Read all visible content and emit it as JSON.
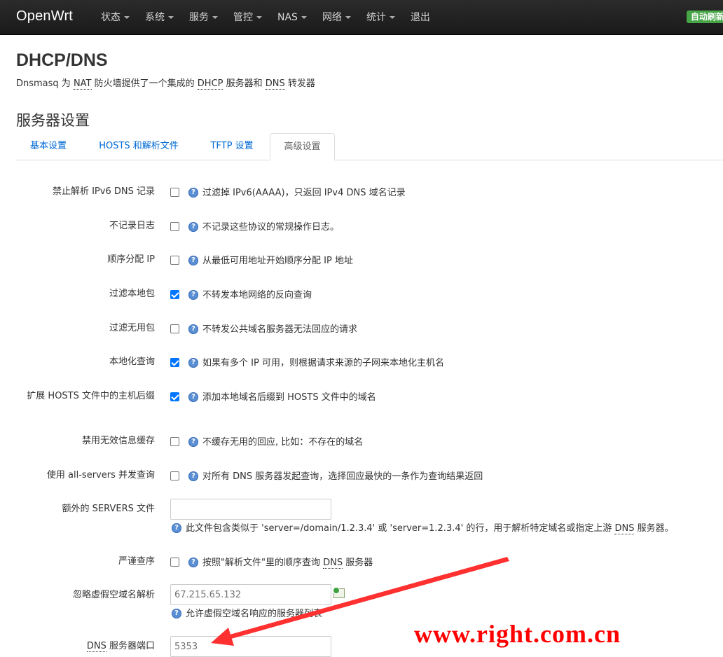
{
  "navbar": {
    "brand": "OpenWrt",
    "menu": [
      "状态",
      "系统",
      "服务",
      "管控",
      "NAS",
      "网络",
      "统计",
      "退出"
    ],
    "auto_refresh": "自动刷新"
  },
  "page": {
    "title": "DHCP/DNS",
    "description": {
      "p1": "Dnsmasq 为 ",
      "nat": "NAT",
      "p2": " 防火墙提供了一个集成的 ",
      "dhcp": "DHCP",
      "p3": " 服务器和 ",
      "dns": "DNS",
      "p4": " 转发器"
    },
    "section_title": "服务器设置"
  },
  "tabs": [
    {
      "label": "基本设置",
      "active": false
    },
    {
      "label": "HOSTS 和解析文件",
      "active": false
    },
    {
      "label": "TFTP 设置",
      "active": false
    },
    {
      "label": "高级设置",
      "active": true
    }
  ],
  "options": [
    {
      "label": "禁止解析 IPv6 DNS 记录",
      "checked": false,
      "help": "过滤掉 IPv6(AAAA)，只返回 IPv4 DNS 域名记录"
    },
    {
      "label": "不记录日志",
      "checked": false,
      "help": "不记录这些协议的常规操作日志。"
    },
    {
      "label": "顺序分配 IP",
      "checked": false,
      "help": "从最低可用地址开始顺序分配 IP 地址"
    },
    {
      "label": "过滤本地包",
      "checked": true,
      "help": "不转发本地网络的反向查询"
    },
    {
      "label": "过滤无用包",
      "checked": false,
      "help": "不转发公共域名服务器无法回应的请求"
    },
    {
      "label": "本地化查询",
      "checked": true,
      "help": "如果有多个 IP 可用，则根据请求来源的子网来本地化主机名"
    },
    {
      "label": "扩展 HOSTS 文件中的主机后缀",
      "checked": true,
      "help": "添加本地域名后缀到 HOSTS 文件中的域名"
    },
    {
      "label": "禁用无效信息缓存",
      "checked": false,
      "help": "不缓存无用的回应, 比如：不存在的域名"
    },
    {
      "label": "使用 all-servers 并发查询",
      "checked": false,
      "help": "对所有 DNS 服务器发起查询，选择回应最快的一条作为查询结果返回"
    }
  ],
  "servers_file": {
    "label": "额外的 SERVERS 文件",
    "value": "",
    "help_before": "此文件包含类似于 'server=/domain/1.2.3.4' 或 'server=1.2.3.4' 的行，用于解析特定域名或指定上游 ",
    "help_dns": "DNS",
    "help_after": " 服务器。"
  },
  "strict_order": {
    "label": "严谨查序",
    "checked": false,
    "help_before": "按照\"解析文件\"里的顺序查询 ",
    "help_dns": "DNS",
    "help_after": " 服务器"
  },
  "bogus_nx": {
    "label": "忽略虚假空域名解析",
    "placeholder": "67.215.65.132",
    "help": "允许虚假空域名响应的服务器列表"
  },
  "dns_port": {
    "label_dns": "DNS",
    "label_rest": " 服务器端口",
    "placeholder": "5353"
  },
  "help_icon_glyph": "?",
  "watermark": "www.right.com.cn",
  "colors": {
    "link": "#0069d6",
    "checkbox_on": "#0075ff",
    "help_icon": "#5b8fd4",
    "watermark": "#ff0000",
    "auto_refresh": "#46a546"
  }
}
